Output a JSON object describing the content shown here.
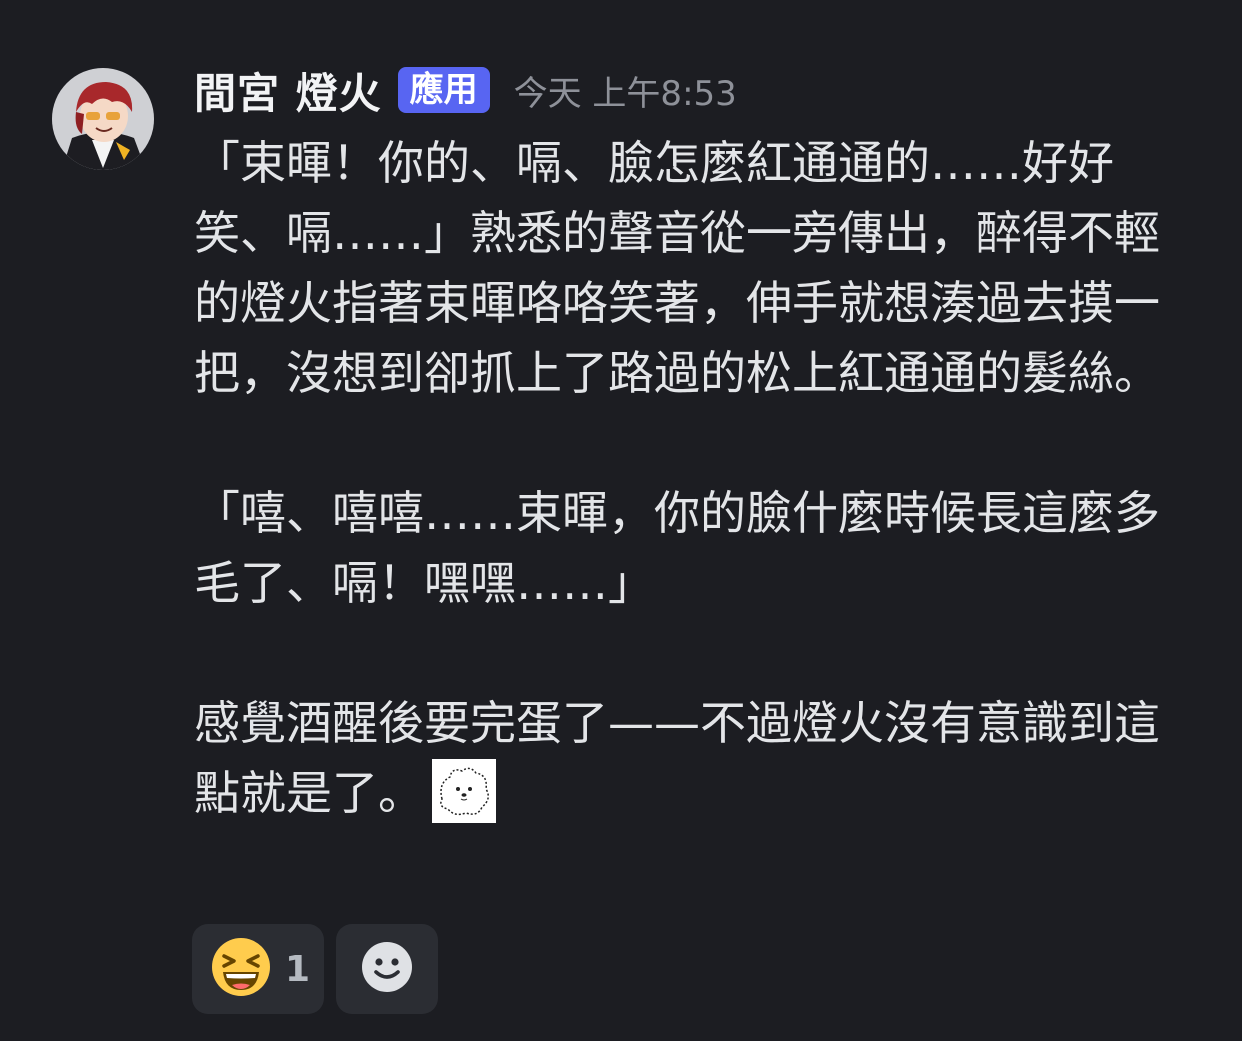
{
  "message": {
    "author": "間宮 燈火",
    "badge": "應用",
    "timestamp": "今天 上午8:53",
    "paragraphs": [
      "「束暉！你的、嗝、臉怎麼紅通通的……好好笑、嗝……」熟悉的聲音從一旁傳出，醉得不輕的燈火指著束暉咯咯笑著，伸手就想湊過去摸一把，沒想到卻抓上了路過的松上紅通通的髮絲。",
      "「嘻、嘻嘻……束暉，你的臉什麼時候長這麼多毛了、嗝！嘿嘿……」",
      "感覺酒醒後要完蛋了——不過燈火沒有意識到這點就是了。"
    ],
    "emote_icon": "white-fluffy-dog-emote"
  },
  "reactions": [
    {
      "icon": "laughing-squint-emoji-icon",
      "count": "1"
    },
    {
      "icon": "add-reaction-smiley-icon"
    }
  ],
  "colors": {
    "background": "#1c1d22",
    "badge": "#5865f2",
    "reaction_bg": "#2b2d33",
    "timestamp": "#8e9199"
  }
}
